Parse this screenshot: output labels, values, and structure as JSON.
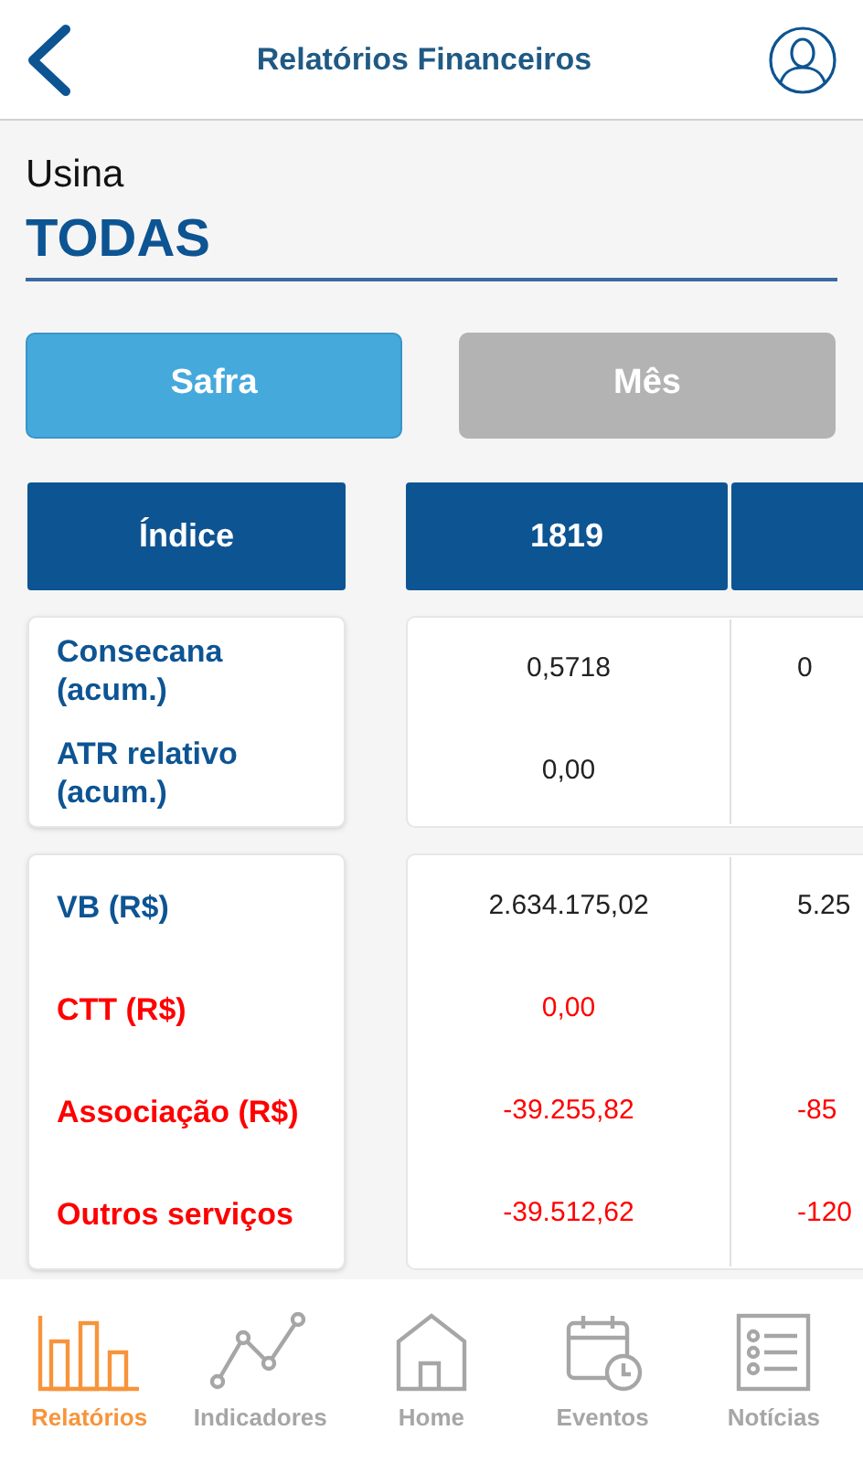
{
  "header": {
    "title": "Relatórios Financeiros"
  },
  "filter": {
    "label": "Usina",
    "value": "TODAS"
  },
  "period_tabs": [
    {
      "label": "Safra",
      "selected": true
    },
    {
      "label": "Mês",
      "selected": false
    }
  ],
  "table": {
    "index_heading": "Índice",
    "columns": [
      "1819"
    ],
    "groups": [
      {
        "rows": [
          {
            "label": "Consecana (acum.)",
            "kind": "index",
            "cells": [
              "0,5718",
              "0"
            ]
          },
          {
            "label": "ATR relativo (acum.)",
            "kind": "index",
            "cells": [
              "0,00"
            ]
          }
        ]
      },
      {
        "rows": [
          {
            "label": "VB (R$)",
            "kind": "index",
            "cells": [
              "2.634.175,02",
              "5.25"
            ]
          },
          {
            "label": "CTT (R$)",
            "kind": "deduction",
            "cells": [
              "0,00"
            ]
          },
          {
            "label": "Associação (R$)",
            "kind": "deduction",
            "cells": [
              "-39.255,82",
              "-85"
            ]
          },
          {
            "label": "Outros serviços",
            "kind": "deduction",
            "cells": [
              "-39.512,62",
              "-120"
            ]
          }
        ]
      }
    ]
  },
  "bottom_nav": [
    {
      "label": "Relatórios",
      "kind": "bars",
      "selected": true
    },
    {
      "label": "Indicadores",
      "kind": "line",
      "selected": false
    },
    {
      "label": "Home",
      "kind": "home",
      "selected": false
    },
    {
      "label": "Eventos",
      "kind": "calendar",
      "selected": false
    },
    {
      "label": "Notícias",
      "kind": "list",
      "selected": false
    }
  ]
}
